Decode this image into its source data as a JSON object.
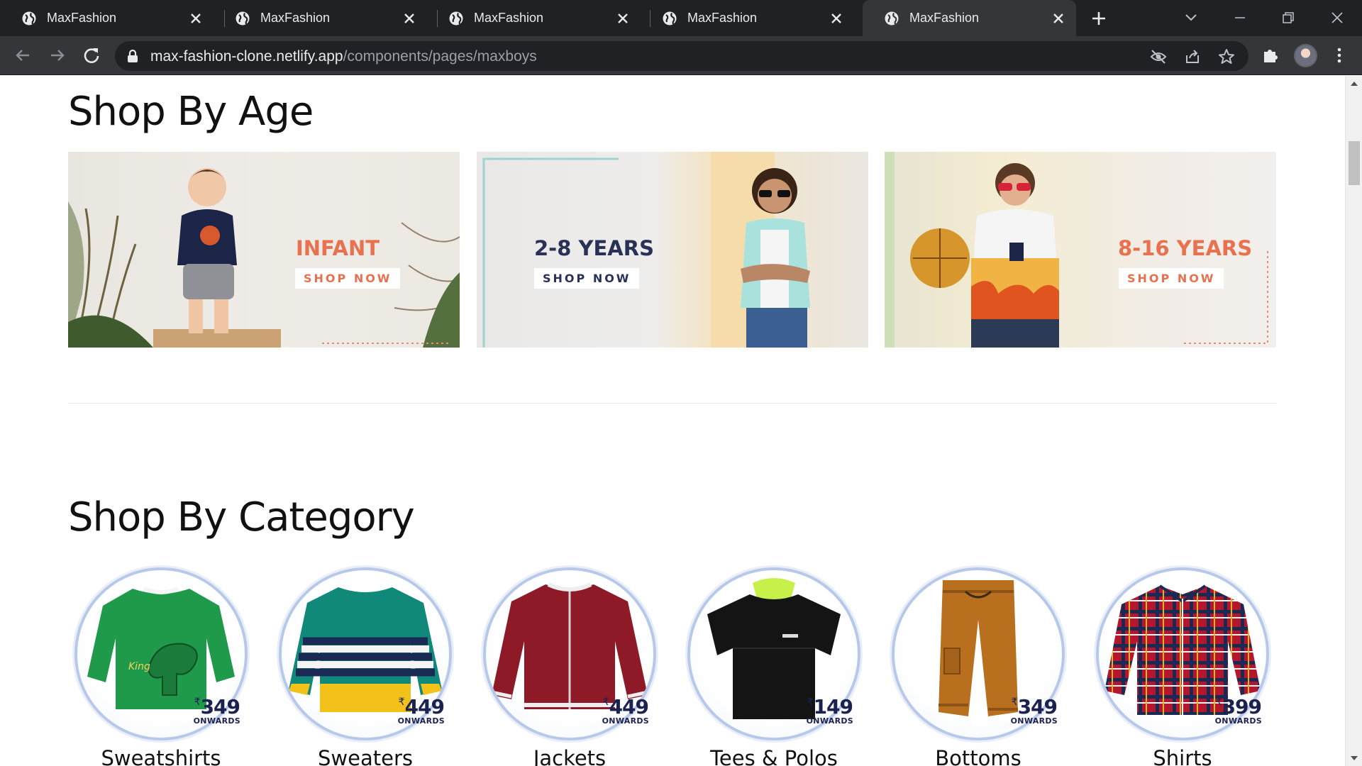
{
  "browser": {
    "tabs": [
      {
        "title": "MaxFashion"
      },
      {
        "title": "MaxFashion"
      },
      {
        "title": "MaxFashion"
      },
      {
        "title": "MaxFashion"
      },
      {
        "title": "MaxFashion"
      }
    ],
    "active_tab": 4,
    "url_host": "max-fashion-clone.netlify.app",
    "url_path": "/components/pages/maxboys"
  },
  "age_section": {
    "title": "Shop By Age",
    "banners": [
      {
        "label": "INFANT",
        "cta": "SHOP NOW",
        "label_color": "#e8724f"
      },
      {
        "label": "2-8 YEARS",
        "cta": "SHOP NOW",
        "label_color": "#2a3157"
      },
      {
        "label": "8-16 YEARS",
        "cta": "SHOP NOW",
        "label_color": "#e8724f"
      }
    ]
  },
  "category_section": {
    "title": "Shop By Category",
    "categories": [
      {
        "name": "Sweatshirts",
        "currency": "₹",
        "price": "349",
        "price_note": "ONWARDS"
      },
      {
        "name": "Sweaters",
        "currency": "₹",
        "price": "449",
        "price_note": "ONWARDS"
      },
      {
        "name": "Jackets",
        "currency": "₹",
        "price": "449",
        "price_note": "ONWARDS"
      },
      {
        "name": "Tees & Polos",
        "currency": "₹",
        "price": "149",
        "price_note": "ONWARDS"
      },
      {
        "name": "Bottoms",
        "currency": "₹",
        "price": "349",
        "price_note": "ONWARDS"
      },
      {
        "name": "Shirts",
        "currency": "₹",
        "price": "399",
        "price_note": "ONWARDS"
      }
    ]
  },
  "icons": {
    "tab_favicon": "globe-icon",
    "tab_close": "close-icon",
    "new_tab": "plus-icon",
    "back": "arrow-left-icon",
    "forward": "arrow-right-icon",
    "reload": "reload-icon",
    "lock": "lock-icon",
    "eye_off": "eye-off-icon",
    "share": "share-icon",
    "bookmark": "star-icon",
    "extensions": "puzzle-icon",
    "menu": "kebab-menu-icon"
  },
  "colors": {
    "tabstrip": "#202124",
    "toolbar": "#35363a",
    "accent_orange": "#e8724f",
    "navy": "#2a3157"
  }
}
